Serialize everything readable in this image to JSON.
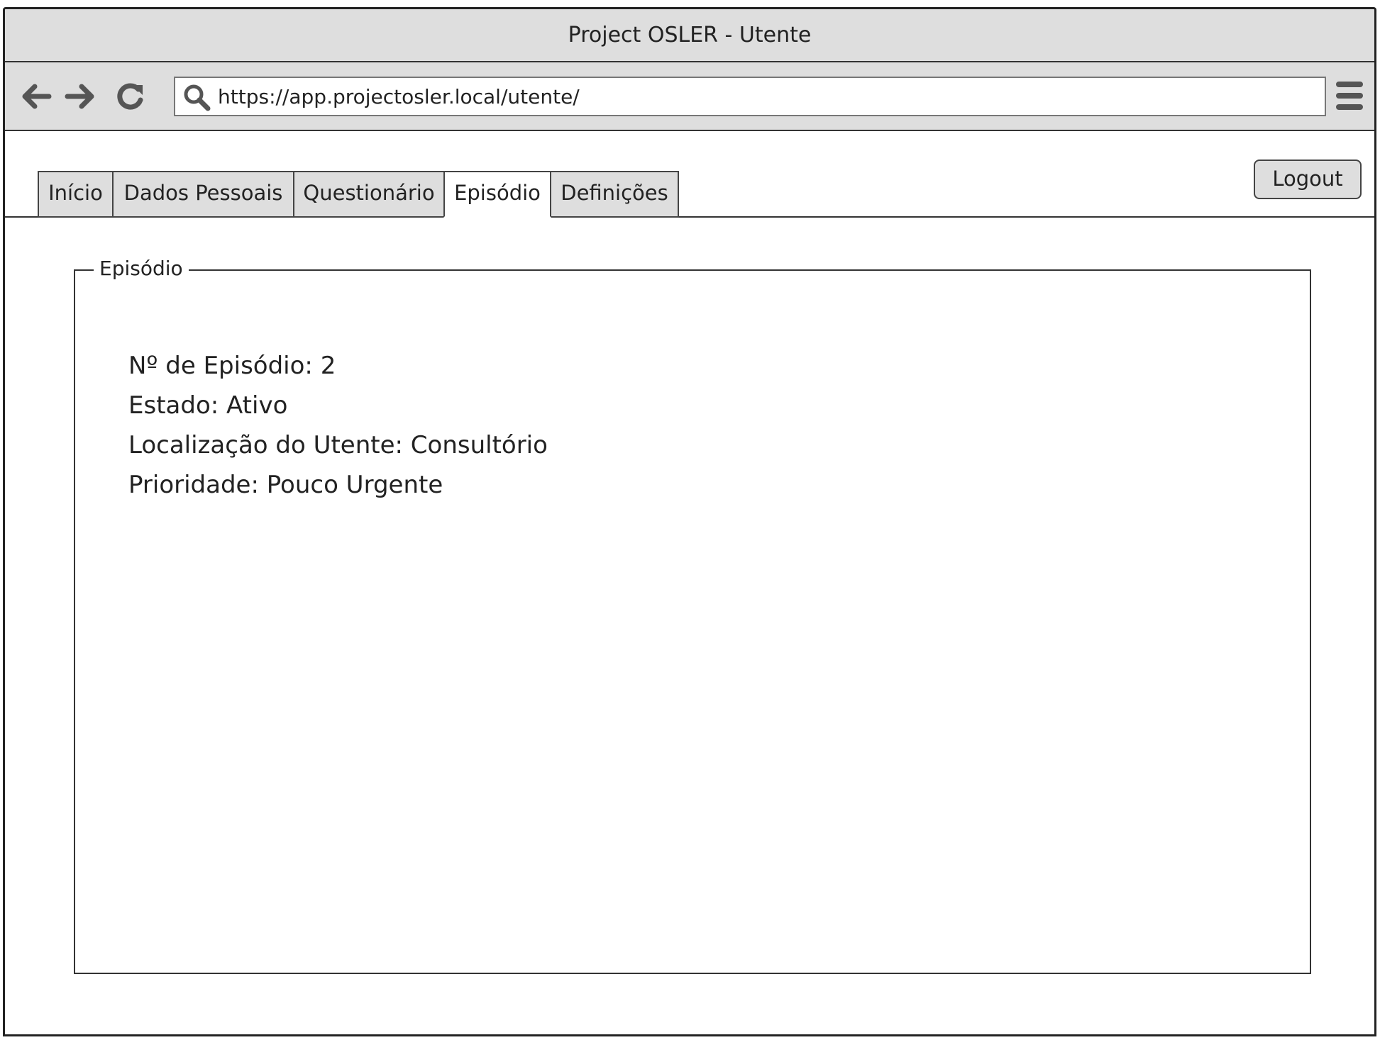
{
  "window": {
    "title": "Project OSLER - Utente"
  },
  "toolbar": {
    "back_icon": "arrow-left-icon",
    "forward_icon": "arrow-right-icon",
    "reload_icon": "reload-icon",
    "search_icon": "search-icon",
    "menu_icon": "hamburger-menu-icon",
    "url": "https://app.projectosler.local/utente/"
  },
  "tabs": [
    {
      "label": "Início",
      "active": false
    },
    {
      "label": "Dados Pessoais",
      "active": false
    },
    {
      "label": "Questionário",
      "active": false
    },
    {
      "label": "Episódio",
      "active": true
    },
    {
      "label": "Definições",
      "active": false
    }
  ],
  "header": {
    "logout_label": "Logout"
  },
  "episode": {
    "section_title": "Episódio",
    "number_line": "Nº de Episódio: 2",
    "status_line": "Estado: Ativo",
    "location_line": "Localização do Utente: Consultório",
    "priority_line": "Prioridade: Pouco Urgente"
  },
  "colors": {
    "chrome_background": "#dedede",
    "border": "#333333",
    "text": "#222222",
    "icon": "#555555"
  }
}
